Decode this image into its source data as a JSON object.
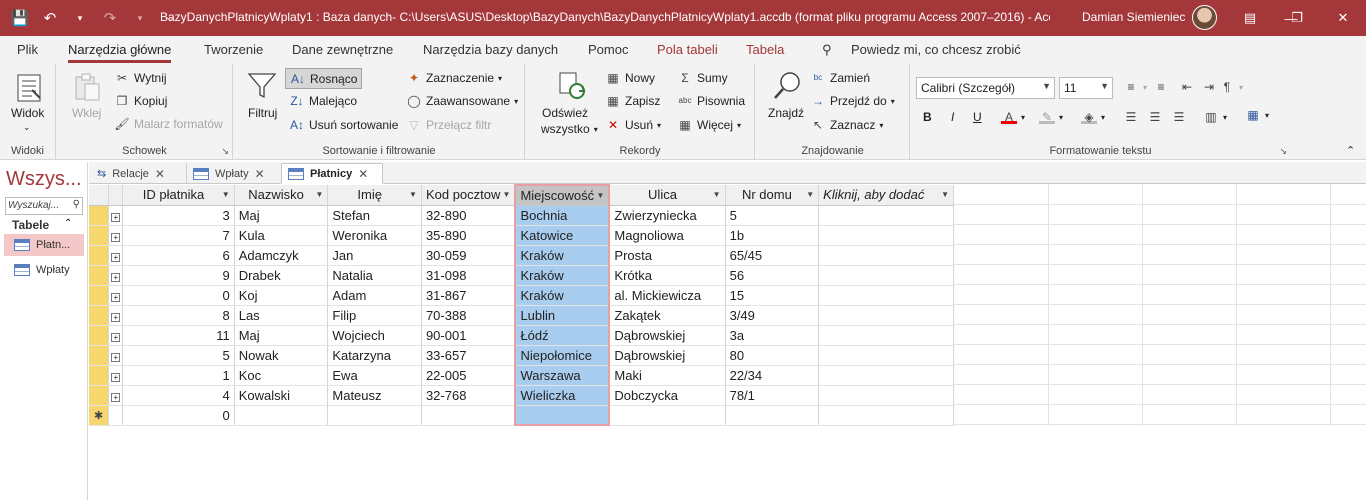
{
  "titlebar": {
    "title": "BazyDanychPlatnicyWplaty1 : Baza danych- C:\\Users\\ASUS\\Desktop\\BazyDanych\\BazyDanychPlatnicyWplaty1.accdb (format pliku programu Access 2007–2016)  -  Acc...",
    "user": "Damian Siemieniec"
  },
  "menu": [
    "Plik",
    "Narzędzia główne",
    "Tworzenie",
    "Dane zewnętrzne",
    "Narzędzia bazy danych",
    "Pomoc",
    "Pola tabeli",
    "Tabela",
    "Powiedz mi, co chcesz zrobić"
  ],
  "ribbon": {
    "widoki": {
      "label": "Widoki",
      "widok": "Widok"
    },
    "schowek": {
      "label": "Schowek",
      "wklej": "Wklej",
      "wytnij": "Wytnij",
      "kopiuj": "Kopiuj",
      "malarz": "Malarz formatów"
    },
    "sort": {
      "label": "Sortowanie i filtrowanie",
      "filtruj": "Filtruj",
      "rosnaco": "Rosnąco",
      "malejaco": "Malejąco",
      "usun": "Usuń sortowanie",
      "zaznaczenie": "Zaznaczenie",
      "zaawansowane": "Zaawansowane",
      "przelacz": "Przełącz filtr"
    },
    "rekordy": {
      "label": "Rekordy",
      "odswiez1": "Odśwież",
      "odswiez2": "wszystko",
      "nowy": "Nowy",
      "zapisz": "Zapisz",
      "usun": "Usuń",
      "sumy": "Sumy",
      "pisownia": "Pisownia",
      "wiecej": "Więcej"
    },
    "znajdowanie": {
      "label": "Znajdowanie",
      "znajdz": "Znajdź",
      "zamien": "Zamień",
      "przejdz": "Przejdź do",
      "zaznacz": "Zaznacz"
    },
    "format": {
      "label": "Formatowanie tekstu",
      "font": "Calibri (Szczegół)",
      "size": "11"
    }
  },
  "nav": {
    "title": "Wszys...",
    "search": "Wyszukaj...",
    "section": "Tabele",
    "items": [
      "Płatn...",
      "Wpłaty"
    ]
  },
  "tabs": [
    "Relacje",
    "Wpłaty",
    "Płatnicy"
  ],
  "table": {
    "headers": [
      "ID płatnika",
      "Nazwisko",
      "Imię",
      "Kod pocztow",
      "Miejscowość",
      "Ulica",
      "Nr domu",
      "Kliknij, aby dodać"
    ],
    "rows": [
      [
        "3",
        "Maj",
        "Stefan",
        "32-890",
        "Bochnia",
        "Zwierzyniecka",
        "5"
      ],
      [
        "7",
        "Kula",
        "Weronika",
        "35-890",
        "Katowice",
        "Magnoliowa",
        "1b"
      ],
      [
        "6",
        "Adamczyk",
        "Jan",
        "30-059",
        "Kraków",
        "Prosta",
        "65/45"
      ],
      [
        "9",
        "Drabek",
        "Natalia",
        "31-098",
        "Kraków",
        "Krótka",
        "56"
      ],
      [
        "0",
        "Koj",
        "Adam",
        "31-867",
        "Kraków",
        "al. Mickiewicza",
        "15"
      ],
      [
        "8",
        "Las",
        "Filip",
        "70-388",
        "Lublin",
        "Zakątek",
        "3/49"
      ],
      [
        "11",
        "Maj",
        "Wojciech",
        "90-001",
        "Łódź",
        "Dąbrowskiej",
        "3a"
      ],
      [
        "5",
        "Nowak",
        "Katarzyna",
        "33-657",
        "Niepołomice",
        "Dąbrowskiej",
        "80"
      ],
      [
        "1",
        "Koc",
        "Ewa",
        "22-005",
        "Warszawa",
        "Maki",
        "22/34"
      ],
      [
        "4",
        "Kowalski",
        "Mateusz",
        "32-768",
        "Wieliczka",
        "Dobczycka",
        "78/1"
      ]
    ],
    "new_row_id": "0"
  },
  "colors": {
    "accent": "#a4373a",
    "selection": "#a9cdee",
    "record_selector": "#f5d76e"
  }
}
